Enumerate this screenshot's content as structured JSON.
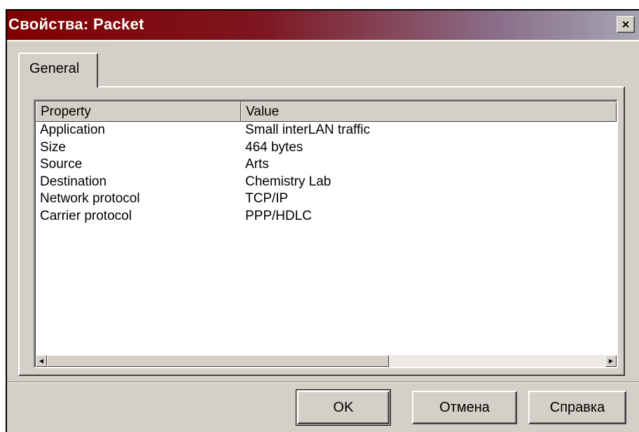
{
  "window": {
    "title": "Свойства: Packet",
    "close_glyph": "×"
  },
  "tabs": [
    {
      "label": "General",
      "selected": true
    }
  ],
  "listview": {
    "columns": [
      "Property",
      "Value"
    ],
    "rows": [
      {
        "property": "Application",
        "value": "Small interLAN traffic"
      },
      {
        "property": "Size",
        "value": "464 bytes"
      },
      {
        "property": "Source",
        "value": "Arts"
      },
      {
        "property": "Destination",
        "value": "Chemistry Lab"
      },
      {
        "property": "Network protocol",
        "value": "TCP/IP"
      },
      {
        "property": "Carrier protocol",
        "value": "PPP/HDLC"
      }
    ]
  },
  "buttons": {
    "ok": "OK",
    "cancel": "Отмена",
    "help": "Справка"
  },
  "icons": {
    "close": "close-icon",
    "scroll_left": "chevron-left-icon",
    "scroll_right": "chevron-right-icon"
  },
  "colors": {
    "title_gradient_start": "#800000",
    "title_gradient_end": "#a6a6b2",
    "face": "#d4d0c8"
  }
}
